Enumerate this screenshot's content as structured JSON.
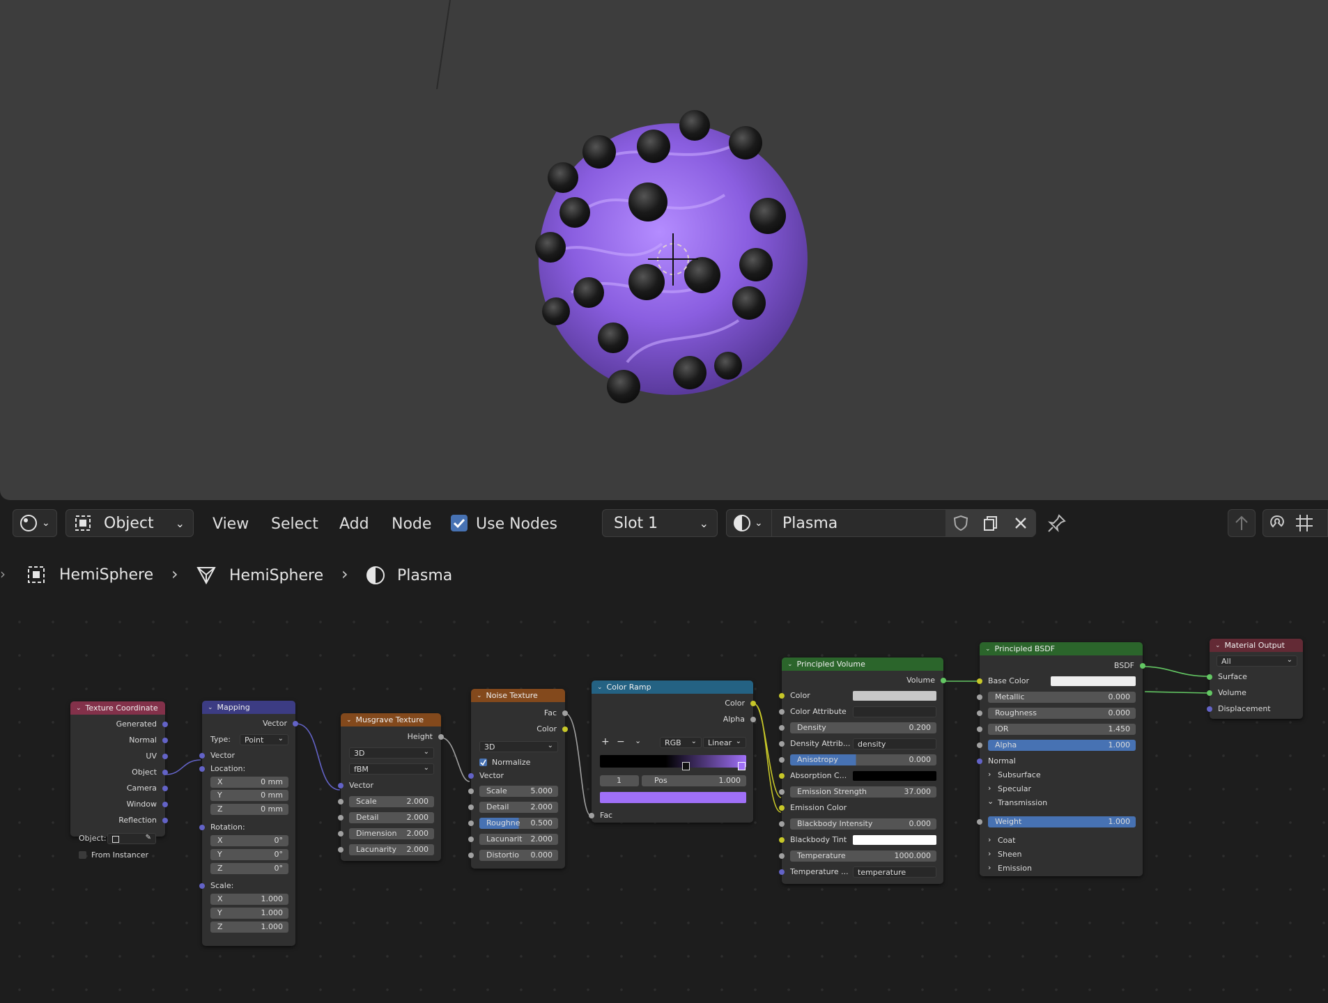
{
  "colors": {
    "accent_blue": "#4772b3",
    "purple": "#a070f8",
    "socket_yellow": "#c7c729",
    "socket_grey": "#a1a1a1",
    "socket_purple": "#6363c7",
    "socket_green": "#63c763",
    "header_input": "#83314a",
    "header_vector": "#3c3c83",
    "header_texture": "#83491c",
    "header_converter": "#246283",
    "header_shader": "#2b652b",
    "header_output": "#632a35"
  },
  "header": {
    "editor_type_icon": "shader-editor-icon",
    "mode": "Object",
    "menus": [
      "View",
      "Select",
      "Add",
      "Node"
    ],
    "use_nodes_label": "Use Nodes",
    "use_nodes_checked": true,
    "slot": "Slot 1",
    "material_name": "Plasma"
  },
  "breadcrumb": [
    "HemiSphere",
    "HemiSphere",
    "Plasma"
  ],
  "nodes": {
    "texcoord": {
      "title": "Texture Coordinate",
      "outputs": [
        "Generated",
        "Normal",
        "UV",
        "Object",
        "Camera",
        "Window",
        "Reflection"
      ],
      "object_label": "Object:",
      "from_instancer": "From Instancer"
    },
    "mapping": {
      "title": "Mapping",
      "out": "Vector",
      "type_label": "Type:",
      "type": "Point",
      "vector": "Vector",
      "location": "Location:",
      "loc": [
        {
          "a": "X",
          "v": "0 mm"
        },
        {
          "a": "Y",
          "v": "0 mm"
        },
        {
          "a": "Z",
          "v": "0 mm"
        }
      ],
      "rotation": "Rotation:",
      "rot": [
        {
          "a": "X",
          "v": "0°"
        },
        {
          "a": "Y",
          "v": "0°"
        },
        {
          "a": "Z",
          "v": "0°"
        }
      ],
      "scale": "Scale:",
      "scl": [
        {
          "a": "X",
          "v": "1.000"
        },
        {
          "a": "Y",
          "v": "1.000"
        },
        {
          "a": "Z",
          "v": "1.000"
        }
      ]
    },
    "musgrave": {
      "title": "Musgrave Texture",
      "out": "Height",
      "dim": "3D",
      "type": "fBM",
      "vector": "Vector",
      "fields": [
        {
          "l": "Scale",
          "v": "2.000"
        },
        {
          "l": "Detail",
          "v": "2.000"
        },
        {
          "l": "Dimension",
          "v": "2.000"
        },
        {
          "l": "Lacunarity",
          "v": "2.000"
        }
      ]
    },
    "noise": {
      "title": "Noise Texture",
      "outs": [
        "Fac",
        "Color"
      ],
      "dim": "3D",
      "normalize": "Normalize",
      "vector": "Vector",
      "fields": [
        {
          "l": "Scale",
          "v": "5.000"
        },
        {
          "l": "Detail",
          "v": "2.000"
        },
        {
          "l": "Roughne",
          "v": "0.500"
        },
        {
          "l": "Lacunarit",
          "v": "2.000"
        },
        {
          "l": "Distortio",
          "v": "0.000"
        }
      ]
    },
    "ramp": {
      "title": "Color Ramp",
      "outs": [
        "Color",
        "Alpha"
      ],
      "mode": "RGB",
      "interp": "Linear",
      "index": "1",
      "pos_label": "Pos",
      "pos": "1.000",
      "fac": "Fac"
    },
    "volume": {
      "title": "Principled Volume",
      "out": "Volume",
      "color": "Color",
      "color_attr": "Color Attribute",
      "density": "Density",
      "density_v": "0.200",
      "density_attr": "Density Attrib...",
      "density_attr_v": "density",
      "aniso": "Anisotropy",
      "aniso_v": "0.000",
      "absorb": "Absorption C...",
      "em_strength": "Emission Strength",
      "em_strength_v": "37.000",
      "em_color": "Emission Color",
      "bb": "Blackbody Intensity",
      "bb_v": "0.000",
      "bb_tint": "Blackbody Tint",
      "temp": "Temperature",
      "temp_v": "1000.000",
      "temp_attr": "Temperature ...",
      "temp_attr_v": "temperature"
    },
    "bsdf": {
      "title": "Principled BSDF",
      "out": "BSDF",
      "base_color": "Base Color",
      "metallic": "Metallic",
      "metallic_v": "0.000",
      "roughness": "Roughness",
      "roughness_v": "0.000",
      "ior": "IOR",
      "ior_v": "1.450",
      "alpha": "Alpha",
      "alpha_v": "1.000",
      "normal": "Normal",
      "subsurface": "Subsurface",
      "specular": "Specular",
      "transmission": "Transmission",
      "weight": "Weight",
      "weight_v": "1.000",
      "coat": "Coat",
      "sheen": "Sheen",
      "emission": "Emission"
    },
    "output": {
      "title": "Material Output",
      "target": "All",
      "inputs": [
        "Surface",
        "Volume",
        "Displacement"
      ]
    }
  }
}
